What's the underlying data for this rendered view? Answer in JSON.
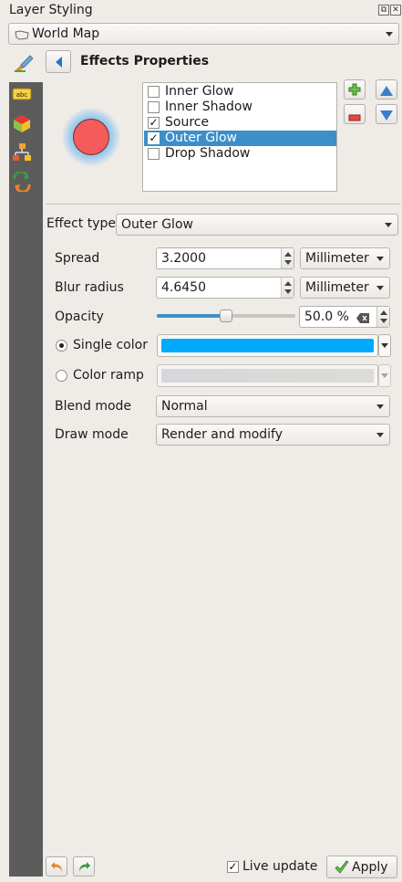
{
  "window": {
    "title": "Layer Styling",
    "float_icon": "float-icon",
    "close_icon": "close-icon"
  },
  "layer_select": {
    "value": "World Map",
    "icon": "polygon-layer-icon"
  },
  "panel": {
    "title": "Effects Properties",
    "back_icon": "back-arrow-icon"
  },
  "sidebar": {
    "items": [
      {
        "icon": "labels-icon"
      },
      {
        "icon": "3d-view-icon"
      },
      {
        "icon": "diagram-icon"
      },
      {
        "icon": "history-icon"
      }
    ]
  },
  "effects": {
    "items": [
      {
        "label": "Inner Glow",
        "checked": false
      },
      {
        "label": "Inner Shadow",
        "checked": false
      },
      {
        "label": "Source",
        "checked": true
      },
      {
        "label": "Outer Glow",
        "checked": true,
        "selected": true
      },
      {
        "label": "Drop Shadow",
        "checked": false
      }
    ],
    "add_icon": "add-effect-icon",
    "remove_icon": "remove-effect-icon",
    "up_icon": "move-up-icon",
    "down_icon": "move-down-icon"
  },
  "effect_type": {
    "label": "Effect type",
    "value": "Outer Glow"
  },
  "form": {
    "spread": {
      "label": "Spread",
      "value": "3.2000",
      "unit": "Millimeter"
    },
    "blur": {
      "label": "Blur radius",
      "value": "4.6450",
      "unit": "Millimeter"
    },
    "opacity": {
      "label": "Opacity",
      "value": "50.0 %",
      "fraction": 0.5
    },
    "single_color": {
      "label": "Single color",
      "selected": true,
      "color": "#00aaff"
    },
    "color_ramp": {
      "label": "Color ramp",
      "selected": false
    },
    "blend_mode": {
      "label": "Blend mode",
      "value": "Normal"
    },
    "draw_mode": {
      "label": "Draw mode",
      "value": "Render and modify"
    }
  },
  "footer": {
    "undo_icon": "undo-icon",
    "redo_icon": "redo-icon",
    "live_update": {
      "label": "Live update",
      "checked": true
    },
    "apply": {
      "label": "Apply",
      "icon": "checkmark-icon"
    }
  },
  "colors": {
    "accent": "#3c8fc9",
    "preview_fill": "#f45b5b",
    "glow": "#3aa6f5"
  }
}
